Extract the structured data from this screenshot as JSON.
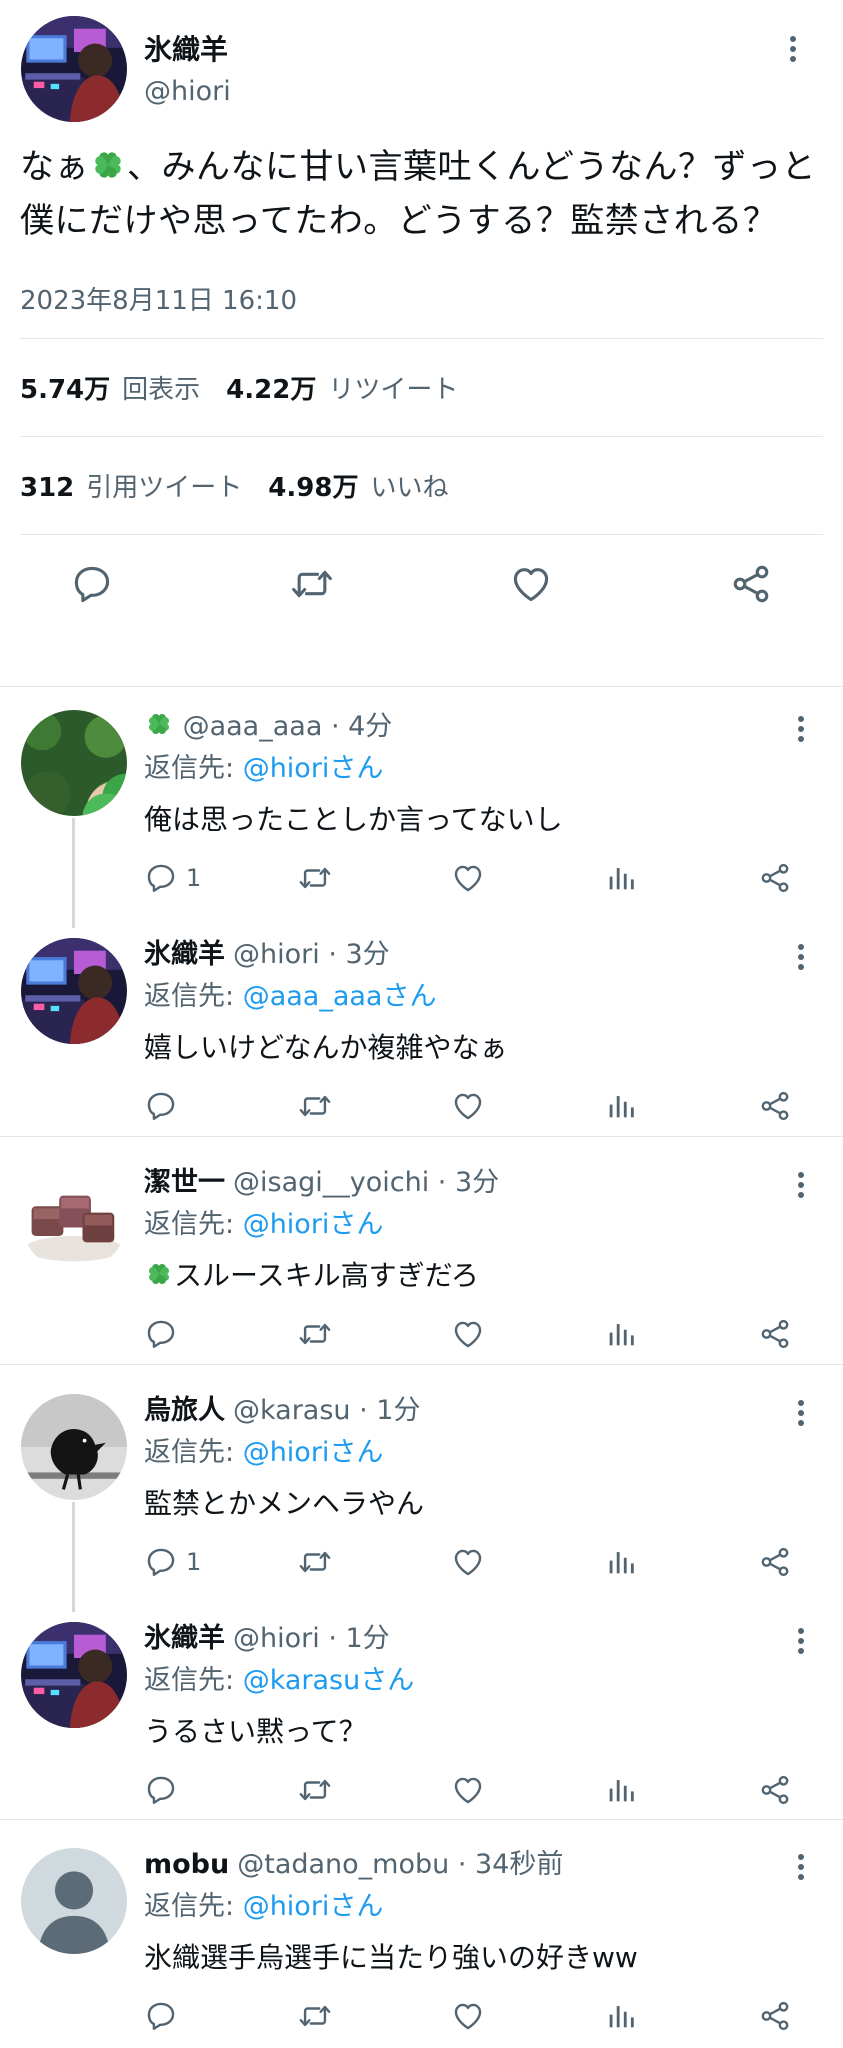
{
  "main_tweet": {
    "name": "氷織羊",
    "handle": "@hiori",
    "text_before": "なぁ",
    "text_after": "、みんなに甘い言葉吐くんどうなん？ずっと僕にだけや思ってたわ。どうする？監禁される？",
    "timestamp": "2023年8月11日 16:10",
    "stats": {
      "views_value": "5.74万",
      "views_label": "回表示",
      "retweets_value": "4.22万",
      "retweets_label": "リツイート",
      "quotes_value": "312",
      "quotes_label": "引用ツイート",
      "likes_value": "4.98万",
      "likes_label": "いいね"
    }
  },
  "replies": [
    {
      "name": "",
      "handle_time": "@aaa_aaa · 4分",
      "reply_prefix": "返信先: ",
      "reply_to": "@hioriさん",
      "text": "俺は思ったことしか言ってないし",
      "reply_count": "1"
    },
    {
      "name": "氷織羊",
      "handle_time": "@hiori · 3分",
      "reply_prefix": "返信先: ",
      "reply_to": "@aaa_aaaさん",
      "text": "嬉しいけどなんか複雑やなぁ",
      "reply_count": ""
    },
    {
      "name": "潔世一",
      "handle_time": "@isagi__yoichi · 3分",
      "reply_prefix": "返信先: ",
      "reply_to": "@hioriさん",
      "text": "スルースキル高すぎだろ",
      "reply_count": ""
    },
    {
      "name": "烏旅人",
      "handle_time": "@karasu · 1分",
      "reply_prefix": "返信先: ",
      "reply_to": "@hioriさん",
      "text": "監禁とかメンヘラやん",
      "reply_count": "1"
    },
    {
      "name": "氷織羊",
      "handle_time": "@hiori · 1分",
      "reply_prefix": "返信先: ",
      "reply_to": "@karasuさん",
      "text": "うるさい黙って？",
      "reply_count": ""
    },
    {
      "name": "mobu",
      "handle_time": "@tadano_mobu · 34秒前",
      "reply_prefix": "返信先: ",
      "reply_to": "@hioriさん",
      "text": "氷織選手烏選手に当たり強いの好きww",
      "reply_count": ""
    }
  ],
  "icons": {
    "reply": "reply-bubble-icon",
    "retweet": "retweet-icon",
    "like": "heart-icon",
    "analytics": "analytics-bars-icon",
    "share": "share-icon",
    "more": "more-vertical-icon",
    "clover": "four-leaf-clover-emoji"
  },
  "colors": {
    "text": "#0f1419",
    "secondary": "#536471",
    "link": "#1d9bf0",
    "divider": "#e1e6ea",
    "clover": "#3aa648"
  }
}
